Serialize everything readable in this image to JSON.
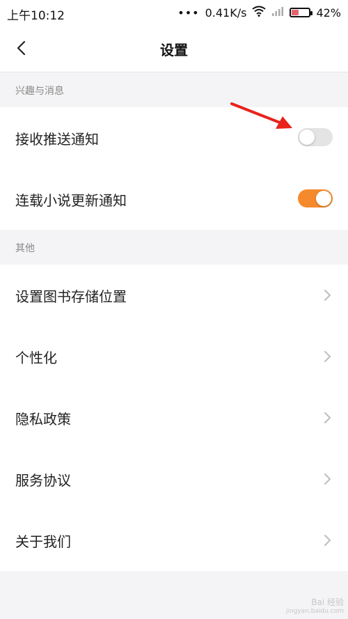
{
  "status_bar": {
    "time": "上午10:12",
    "dots": "•••",
    "network_speed": "0.41K/s",
    "battery_percent": "42%",
    "battery_level": 0.42,
    "battery_color": "#e36470"
  },
  "header": {
    "title": "设置",
    "back_icon": "chevron-left-icon"
  },
  "sections": [
    {
      "title": "兴趣与消息",
      "items": [
        {
          "label": "接收推送通知",
          "control": "toggle",
          "on": false
        },
        {
          "label": "连载小说更新通知",
          "control": "toggle",
          "on": true
        }
      ]
    },
    {
      "title": "其他",
      "items": [
        {
          "label": "设置图书存储位置",
          "control": "chevron"
        },
        {
          "label": "个性化",
          "control": "chevron"
        },
        {
          "label": "隐私政策",
          "control": "chevron"
        },
        {
          "label": "服务协议",
          "control": "chevron"
        },
        {
          "label": "关于我们",
          "control": "chevron"
        }
      ]
    }
  ],
  "colors": {
    "accent": "#f58a2d",
    "annotation_arrow": "#e8231c"
  },
  "watermark": {
    "line1": "Bai 经验",
    "line2": "jingyan.baidu.com"
  }
}
